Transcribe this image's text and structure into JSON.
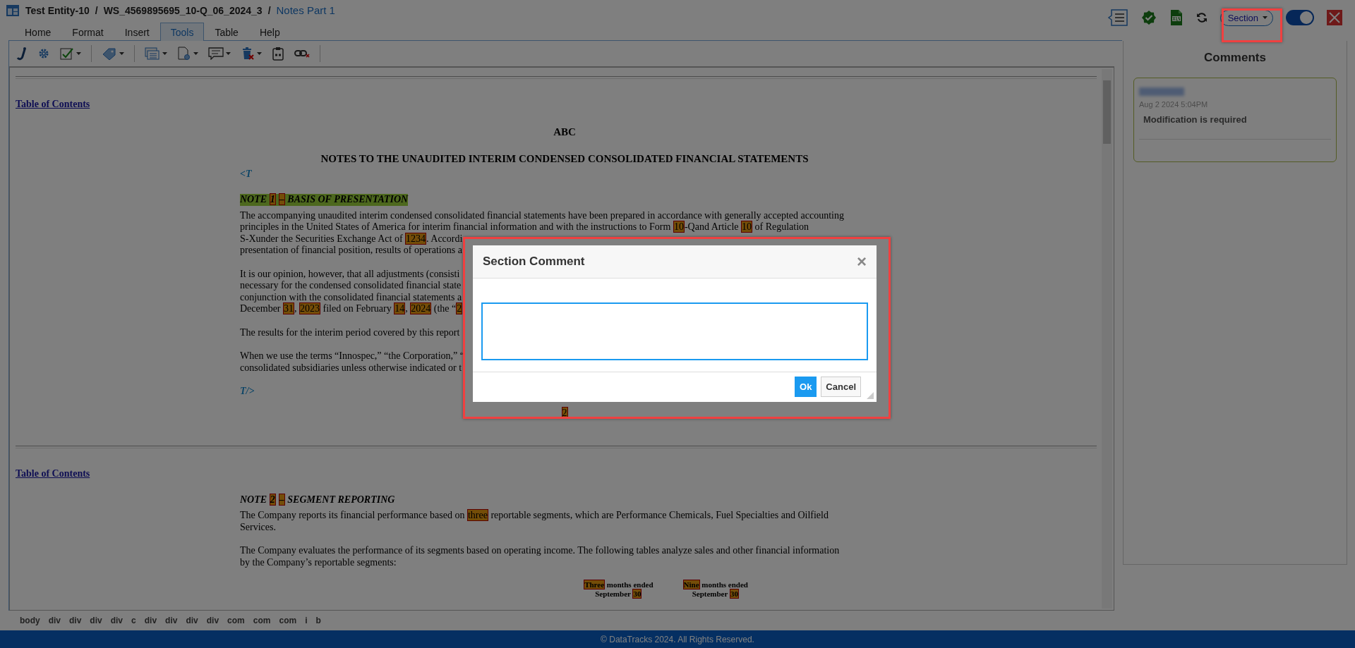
{
  "header": {
    "path": [
      "Test Entity-10",
      "/",
      "WS_4569895695_10-Q_06_2024_3",
      "/",
      "Notes Part 1"
    ]
  },
  "tabs": [
    {
      "label": "Home",
      "selected": false
    },
    {
      "label": "Format",
      "selected": false
    },
    {
      "label": "Insert",
      "selected": false
    },
    {
      "label": "Tools",
      "selected": true
    },
    {
      "label": "Table",
      "selected": false
    },
    {
      "label": "Help",
      "selected": false
    }
  ],
  "actions": {
    "section_dropdown": "Section",
    "toggle": {
      "on": true
    }
  },
  "document": {
    "sections": [
      [
        {
          "kind": "toc",
          "text": "Table of Contents"
        },
        {
          "kind": "heading",
          "text": "ABC"
        },
        {
          "kind": "heading",
          "text": "NOTES TO THE UNAUDITED INTERIM CONDENSED CONSOLIDATED FINANCIAL STATEMENTS"
        },
        {
          "kind": "tag",
          "text": "<T"
        },
        {
          "kind": "note",
          "marked": true,
          "parts": [
            {
              "text": "NOTE ",
              "highlighted": false
            },
            {
              "text": "1",
              "highlighted": true
            },
            {
              "text": "–",
              "highlighted": true
            },
            {
              "text": " BASIS OF PRESENTATION",
              "highlighted": false
            }
          ]
        },
        {
          "kind": "para",
          "lines": [
            [
              {
                "text": "The accompanying unaudited interim condensed consolidated financial statements have been prepared in accordance with generally accepted accounting",
                "highlighted": false
              }
            ],
            [
              {
                "text": "principles in the United States of America for interim financial information and with the instructions to Form ",
                "highlighted": false
              },
              {
                "text": "10",
                "highlighted": true
              },
              {
                "text": "-Qand Article ",
                "highlighted": false
              },
              {
                "text": "10",
                "highlighted": true
              },
              {
                "text": " of Regulation",
                "highlighted": false
              }
            ],
            [
              {
                "text": "S-Xunder the Securities Exchange Act of ",
                "highlighted": false
              },
              {
                "text": "1234",
                "highlighted": true
              },
              {
                "text": ". Accordi",
                "highlighted": false
              }
            ],
            [
              {
                "text": "presentation of financial position, results of operations a",
                "highlighted": false
              }
            ]
          ]
        },
        {
          "kind": "para",
          "lines": [
            [
              {
                "text": "It is our opinion, however, that all adjustments (consisti",
                "highlighted": false
              }
            ],
            [
              {
                "text": "necessary for the condensed consolidated financial state",
                "highlighted": false
              }
            ],
            [
              {
                "text": "conjunction with the consolidated financial statements a",
                "highlighted": false
              }
            ],
            [
              {
                "text": "December ",
                "highlighted": false
              },
              {
                "text": "31",
                "highlighted": true
              },
              {
                "text": ", ",
                "highlighted": false
              },
              {
                "text": "2023",
                "highlighted": true
              },
              {
                "text": " filed on February ",
                "highlighted": false
              },
              {
                "text": "14",
                "highlighted": true
              },
              {
                "text": ", ",
                "highlighted": false
              },
              {
                "text": "2024",
                "highlighted": true
              },
              {
                "text": " (the “",
                "highlighted": false
              },
              {
                "text": "2",
                "highlighted": true
              }
            ]
          ]
        },
        {
          "kind": "para",
          "lines": [
            [
              {
                "text": "The results for the interim period covered by this report",
                "highlighted": false
              }
            ]
          ]
        },
        {
          "kind": "para",
          "lines": [
            [
              {
                "text": "When we use the terms “Innospec,” “the Corporation,” “",
                "highlighted": false
              }
            ],
            [
              {
                "text": "consolidated subsidiaries unless otherwise indicated or t",
                "highlighted": false
              }
            ]
          ]
        },
        {
          "kind": "tag",
          "text": "T/>"
        },
        {
          "kind": "marker",
          "parts": [
            {
              "text": "2",
              "highlighted": true
            }
          ]
        }
      ],
      [
        {
          "kind": "toc",
          "text": "Table of Contents"
        },
        {
          "kind": "note",
          "marked": false,
          "parts": [
            {
              "text": "NOTE ",
              "highlighted": false
            },
            {
              "text": "2",
              "highlighted": true
            },
            {
              "text": "–",
              "highlighted": true
            },
            {
              "text": " SEGMENT REPORTING",
              "highlighted": false
            }
          ]
        },
        {
          "kind": "para",
          "lines": [
            [
              {
                "text": "The Company reports its financial performance based on ",
                "highlighted": false
              },
              {
                "text": "three",
                "highlighted": true
              },
              {
                "text": " reportable segments, which are Performance Chemicals, Fuel Specialties and Oilfield",
                "highlighted": false
              }
            ],
            [
              {
                "text": "Services.",
                "highlighted": false
              }
            ]
          ]
        },
        {
          "kind": "para",
          "lines": [
            [
              {
                "text": "The Company evaluates the performance of its segments based on operating income. The following tables analyze sales and other financial information",
                "highlighted": false
              }
            ],
            [
              {
                "text": "by the Company’s reportable segments:",
                "highlighted": false
              }
            ]
          ]
        },
        {
          "kind": "colheads",
          "columns": [
            [
              [
                {
                  "text": "Three",
                  "highlighted": true
                },
                {
                  "text": " months ended",
                  "highlighted": false
                }
              ],
              [
                {
                  "text": "September ",
                  "highlighted": false
                },
                {
                  "text": "30",
                  "highlighted": true
                }
              ]
            ],
            [
              [
                {
                  "text": "Nine",
                  "highlighted": true
                },
                {
                  "text": " months ended",
                  "highlighted": false
                }
              ],
              [
                {
                  "text": "September ",
                  "highlighted": false
                },
                {
                  "text": "30",
                  "highlighted": true
                }
              ]
            ]
          ]
        }
      ]
    ]
  },
  "comments": {
    "title": "Comments",
    "items": [
      {
        "date": "Aug 2 2024 5:04PM",
        "text": "Modification is required"
      }
    ]
  },
  "element_path": [
    "body",
    "div",
    "div",
    "div",
    "div",
    "c",
    "div",
    "div",
    "div",
    "div",
    "com",
    "com",
    "com",
    "i",
    "b"
  ],
  "footer": "© DataTracks 2024. All Rights Reserved.",
  "dialog": {
    "title": "Section Comment",
    "close": "×",
    "buttons": [
      {
        "label": "Ok",
        "kind": "primary"
      },
      {
        "label": "Cancel",
        "kind": "default"
      }
    ]
  }
}
